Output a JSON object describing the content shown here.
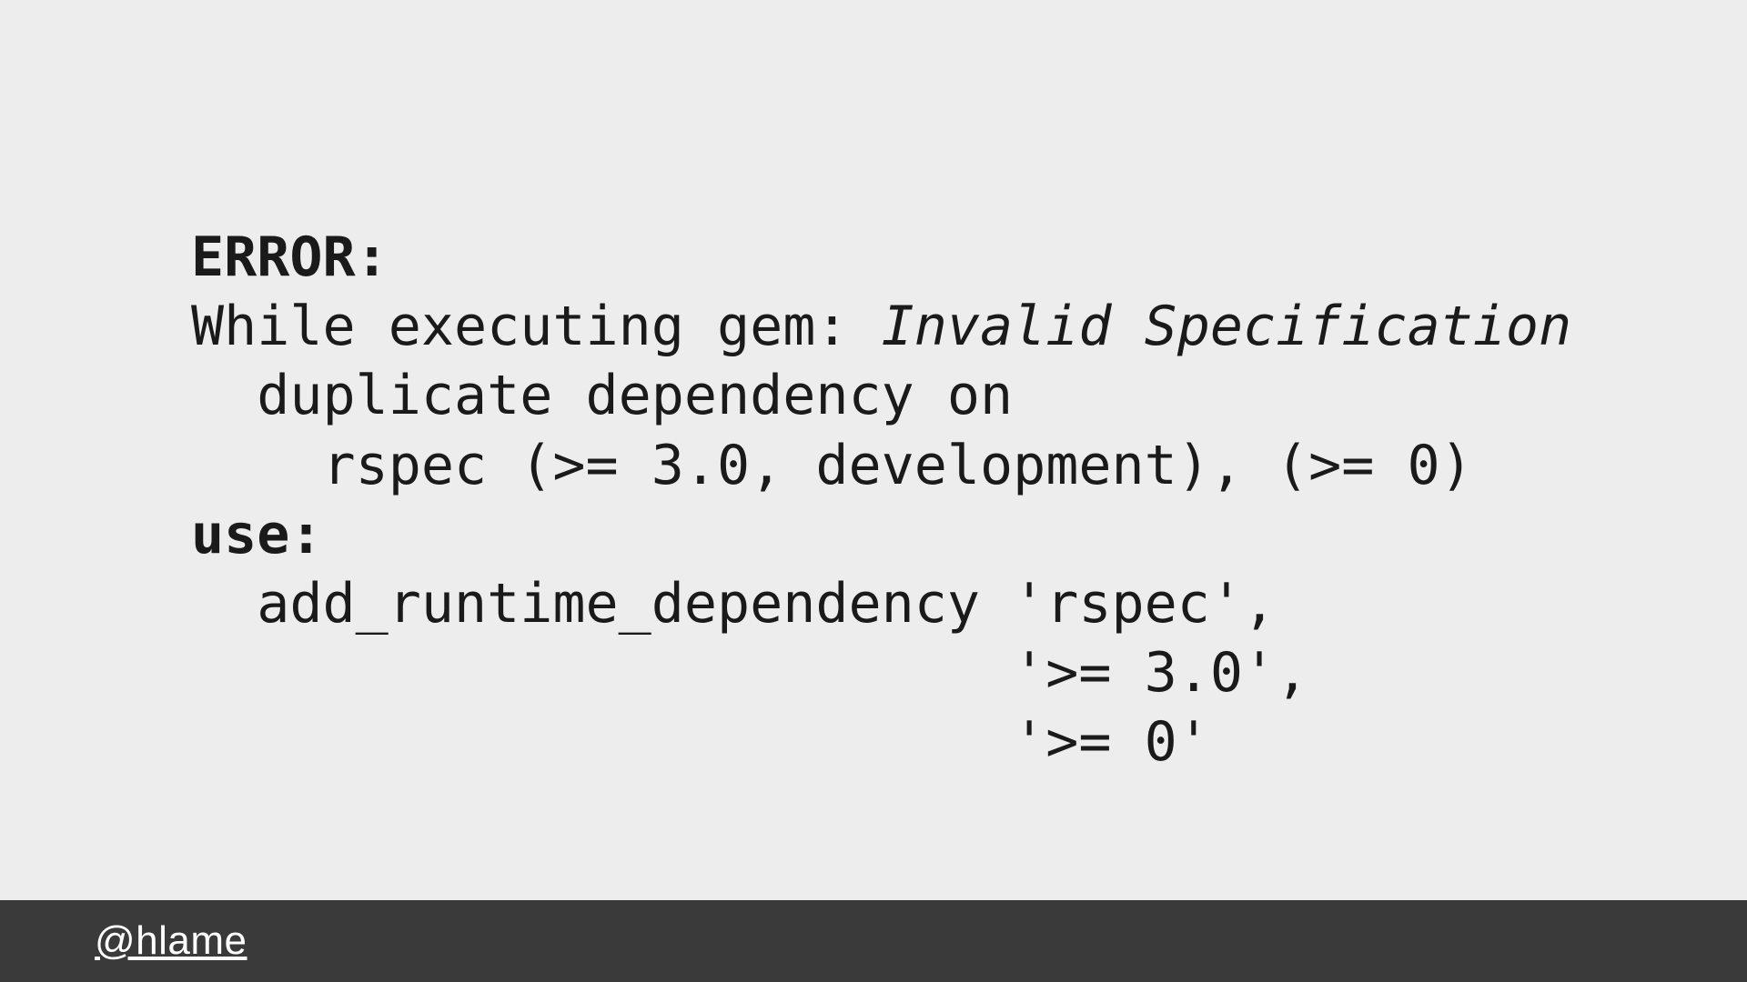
{
  "slide": {
    "line1_bold": "ERROR:",
    "line2_prefix": "While executing gem: ",
    "line2_italic": "Invalid Specification",
    "line3": "  duplicate dependency on",
    "line4": "    rspec (>= 3.0, development), (>= 0)",
    "line5_bold": "use:",
    "line6": "  add_runtime_dependency 'rspec',",
    "line7": "                         '>= 3.0',",
    "line8": "                         '>= 0'"
  },
  "footer": {
    "handle": "@hlame"
  }
}
